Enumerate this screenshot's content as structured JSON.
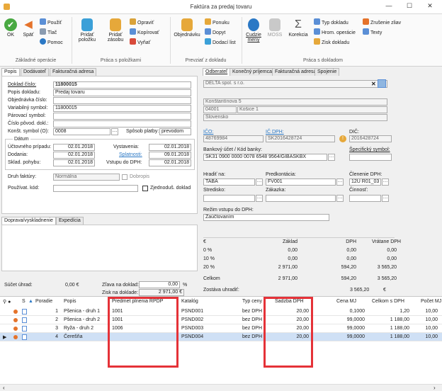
{
  "window": {
    "title": "Faktúra za predaj tovaru",
    "min": "—",
    "max": "☐",
    "close": "✕"
  },
  "ribbon": {
    "ok": "OK",
    "back": "Späť",
    "use": "Použiť",
    "print": "Tlač",
    "help": "Pomoc",
    "add_item": "Pridať položku",
    "add_stock": "Pridať zásobu",
    "edit": "Opraviť",
    "copy": "Kopírovať",
    "cut": "Vyňať",
    "order": "Objednávku",
    "offer": "Ponuku",
    "inquiry": "Dopyt",
    "delivery": "Dodací list",
    "foreign": "Cudzie meny",
    "moss": "MOSS",
    "correction": "Korekcia",
    "doc_type": "Typ dokladu",
    "bulk": "Hrom. operácie",
    "profit": "Zisk dokladu",
    "discount": "Zrušenie zliav",
    "texts": "Texty",
    "g1": "Základné operácie",
    "g2": "Práca s položkami",
    "g3": "Prevziať z dokladu",
    "g4": "Práca s dokladom"
  },
  "left": {
    "tabs": [
      "Popis",
      "Dodávateľ",
      "Fakturačná adresa"
    ],
    "doc_no_label": "Doklad číslo:",
    "doc_no": "11800015",
    "desc_label": "Popis dokladu:",
    "desc": "Predaj tovaru",
    "order_no_label": "Objednávka číslo:",
    "var_sym_label": "Variabilný symbol:",
    "var_sym": "11800015",
    "pair_sym_label": "Párovací symbol:",
    "orig_doc_label": "Číslo pôvod. dokl.:",
    "const_sym_label": "Konšt. symbol (O):",
    "const_sym": "0008",
    "pay_label": "Spôsob platby:",
    "pay": "prevodom",
    "dates_title": "Dátum",
    "acc_label": "Účtovného prípadu:",
    "acc": "02.01.2018",
    "issue_label": "Vystavenia:",
    "issue": "02.01.2018",
    "deliv_label": "Dodania:",
    "deliv": "02.01.2018",
    "due_label": "Splatnosti:",
    "due": "09.01.2018",
    "stock_label": "Sklad. pohybu:",
    "stock": "02.01.2018",
    "vat_in_label": "Vstupu do DPH:",
    "vat_in": "02.01.2018",
    "kind_label": "Druh faktúry:",
    "kind": "Normálna",
    "extra": "Dobropis",
    "user_label": "Používat. kód:",
    "simple": "Zjednoduš. doklad",
    "tabs2": [
      "Doprava/vyskladnenie",
      "Expedícia"
    ],
    "sum_paid_label": "Súčet úhrad:",
    "sum_paid": "0,00 €",
    "disc_label": "Zľava na doklad:",
    "disc": "0,00",
    "pct": "%",
    "profit_label": "Zisk na doklade:",
    "profit": "2 971,00 €"
  },
  "right": {
    "tabs": [
      "Odberateľ",
      "Konečný príjemca",
      "Fakturačná adresa",
      "Spojenie"
    ],
    "company": "DELTA spol. s r.o.",
    "street": "Konštantínova 5",
    "zip": "04001",
    "city": "Košice 1",
    "country": "Slovensko",
    "ico_label": "IČO:",
    "ico": "48769984",
    "icdph_label": "IČ DPH:",
    "icdph": "SK2016428724",
    "dic_label": "DIČ:",
    "dic": "2016428724",
    "bank_label": "Bankový účet / Kód banky:",
    "bank": "SK31 0900 0000 0078 6548 9564/GIBASKBX",
    "spec_label": "Špecifický symbol:",
    "center_label": "Hradiť na:",
    "center": "TABA",
    "prekont_label": "Predkontácia:",
    "prekont": "FV001",
    "vatsplit_label": "Členenie DPH:",
    "vatsplit": "12U R01_03",
    "stred_label": "Stredisko:",
    "zakazka_label": "Zákazka:",
    "cinnost_label": "Činnosť:",
    "regime_label": "Režim vstupu do DPH:",
    "regime": "Zaúčtovaním",
    "vat_head": [
      "€",
      "Základ",
      "DPH",
      "Vrátane DPH"
    ],
    "vat_rows": [
      [
        "0 %",
        "0,00",
        "0,00",
        "0,00"
      ],
      [
        "10 %",
        "0,00",
        "0,00",
        "0,00"
      ],
      [
        "20 %",
        "2 971,00",
        "594,20",
        "3 565,20"
      ],
      [
        "Celkom",
        "2 971,00",
        "594,20",
        "3 565,20"
      ]
    ],
    "remain_label": "Zostáva uhradiť:",
    "remain": "3 565,20",
    "remain_cur": "€"
  },
  "grid": {
    "headers": [
      "S",
      "Poradie",
      "Popis",
      "Predmet plnenia RPDP",
      "Katalóg",
      "Typ ceny",
      "Sadzba DPH",
      "Cena MJ",
      "Celkom s DPH",
      "Počet MJ"
    ],
    "rows": [
      [
        "1",
        "Pšenica - druh 1",
        "1001",
        "PSND001",
        "bez DPH",
        "20,00",
        "0,1000",
        "1,20",
        "10,00"
      ],
      [
        "2",
        "Pšenica - druh 2",
        "1001",
        "PSND002",
        "bez DPH",
        "20,00",
        "99,0000",
        "1 188,00",
        "10,00"
      ],
      [
        "3",
        "Ryža - druh 2",
        "1006",
        "PSND003",
        "bez DPH",
        "20,00",
        "99,0000",
        "1 188,00",
        "10,00"
      ],
      [
        "4",
        "Čerešňa",
        "",
        "PSND004",
        "bez DPH",
        "20,00",
        "99,0000",
        "1 188,00",
        "10,00"
      ]
    ]
  },
  "colors": {
    "accent": "#2b78c5",
    "selection": "#cfe0f5",
    "highlight": "#e53238"
  }
}
